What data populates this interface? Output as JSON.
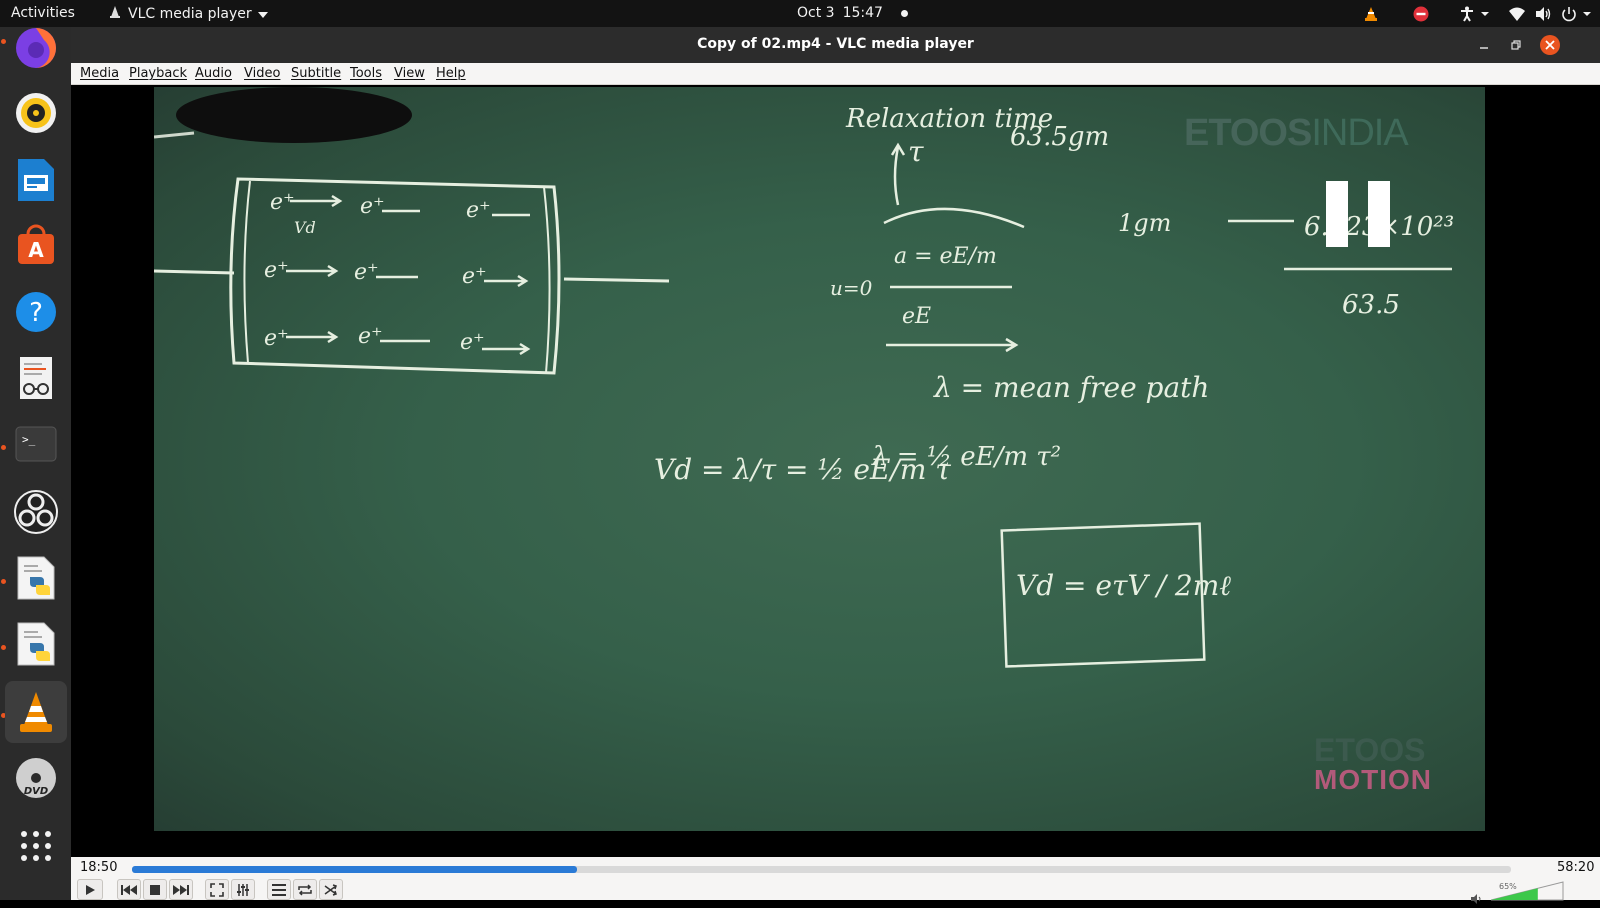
{
  "topbar": {
    "activities": "Activities",
    "app_menu": "VLC media player",
    "date": "Oct 3",
    "time": "15:47"
  },
  "dock": {
    "items": [
      {
        "name": "firefox",
        "running": true
      },
      {
        "name": "rhythmbox",
        "running": false
      },
      {
        "name": "libreoffice-impress",
        "running": false
      },
      {
        "name": "ubuntu-software",
        "running": false
      },
      {
        "name": "help",
        "running": false
      },
      {
        "name": "document-viewer",
        "running": false
      },
      {
        "name": "terminal",
        "running": true
      },
      {
        "name": "obs-studio",
        "running": false
      },
      {
        "name": "python-file-1",
        "running": true
      },
      {
        "name": "python-file-2",
        "running": true
      },
      {
        "name": "vlc",
        "running": true
      },
      {
        "name": "dvd",
        "running": false
      },
      {
        "name": "show-applications",
        "running": false
      }
    ]
  },
  "window": {
    "title": "Copy of 02.mp4 - VLC media player"
  },
  "menubar": {
    "items": [
      "Media",
      "Playback",
      "Audio",
      "Video",
      "Subtitle",
      "Tools",
      "View",
      "Help"
    ]
  },
  "video": {
    "watermark_top_a": "ETOOS",
    "watermark_top_b": "INDIA",
    "watermark_bottom_1": "ETOOS",
    "watermark_bottom_2": "MOTION",
    "board": {
      "relaxation_label": "Relaxation time",
      "tau": "τ",
      "mass_note": "63.5gm",
      "accel": "a = eE/m",
      "u0": "u=0",
      "ee": "eE",
      "mean_free_path": "λ = mean free path",
      "lambda_eq": "λ = ½ eE/m τ²",
      "vd_eq": "Vd = λ/τ = ½ eE/m τ",
      "boxed": "Vd = eτV / 2mℓ",
      "avogadro": "6.023×10²³",
      "one_gm": "1gm",
      "denominator": "63.5",
      "charges": [
        "e⁺",
        "e⁺",
        "e⁺",
        "e⁺",
        "e⁺",
        "e⁺",
        "e⁺",
        "e⁺",
        "e⁺"
      ],
      "vd_label": "Vd"
    }
  },
  "controls": {
    "elapsed": "18:50",
    "total": "58:20",
    "progress": 0.323,
    "volume_label": "65%",
    "volume": 0.65
  }
}
